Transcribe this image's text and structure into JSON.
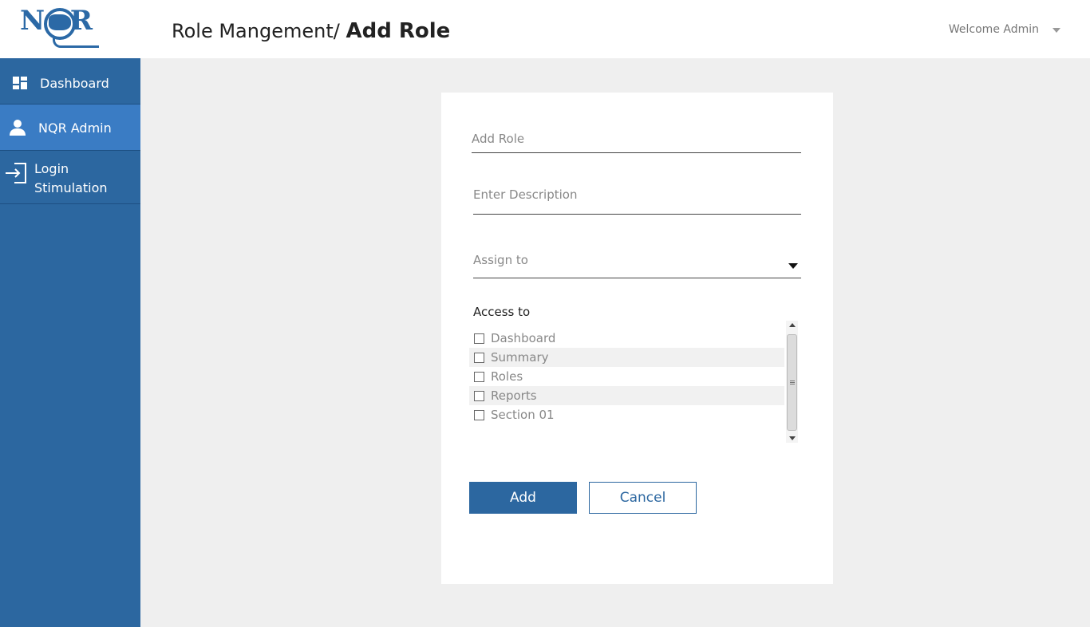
{
  "logo": {
    "text": "NQR"
  },
  "sidebar": {
    "items": [
      {
        "label": "Dashboard",
        "icon": "dashboard-grid-icon"
      },
      {
        "label": "NQR Admin",
        "icon": "person-icon",
        "active": true
      },
      {
        "label_line1": "Login",
        "label_line2": "Stimulation",
        "icon": "login-arrow-icon"
      }
    ]
  },
  "header": {
    "breadcrumb_parent": "Role Mangement/",
    "breadcrumb_current": "Add Role",
    "welcome": "Welcome Admin"
  },
  "form": {
    "role_placeholder": "Add Role",
    "description_placeholder": "Enter Description",
    "assign_placeholder": "Assign to",
    "access_label": "Access to",
    "access_options": [
      "Dashboard",
      "Summary",
      "Roles",
      "Reports",
      "Section 01"
    ],
    "add_label": "Add",
    "cancel_label": "Cancel"
  },
  "colors": {
    "sidebar": "#2c67a0",
    "sidebar_active": "#3a7cc4",
    "background": "#efefef",
    "primary": "#2c67a0"
  }
}
